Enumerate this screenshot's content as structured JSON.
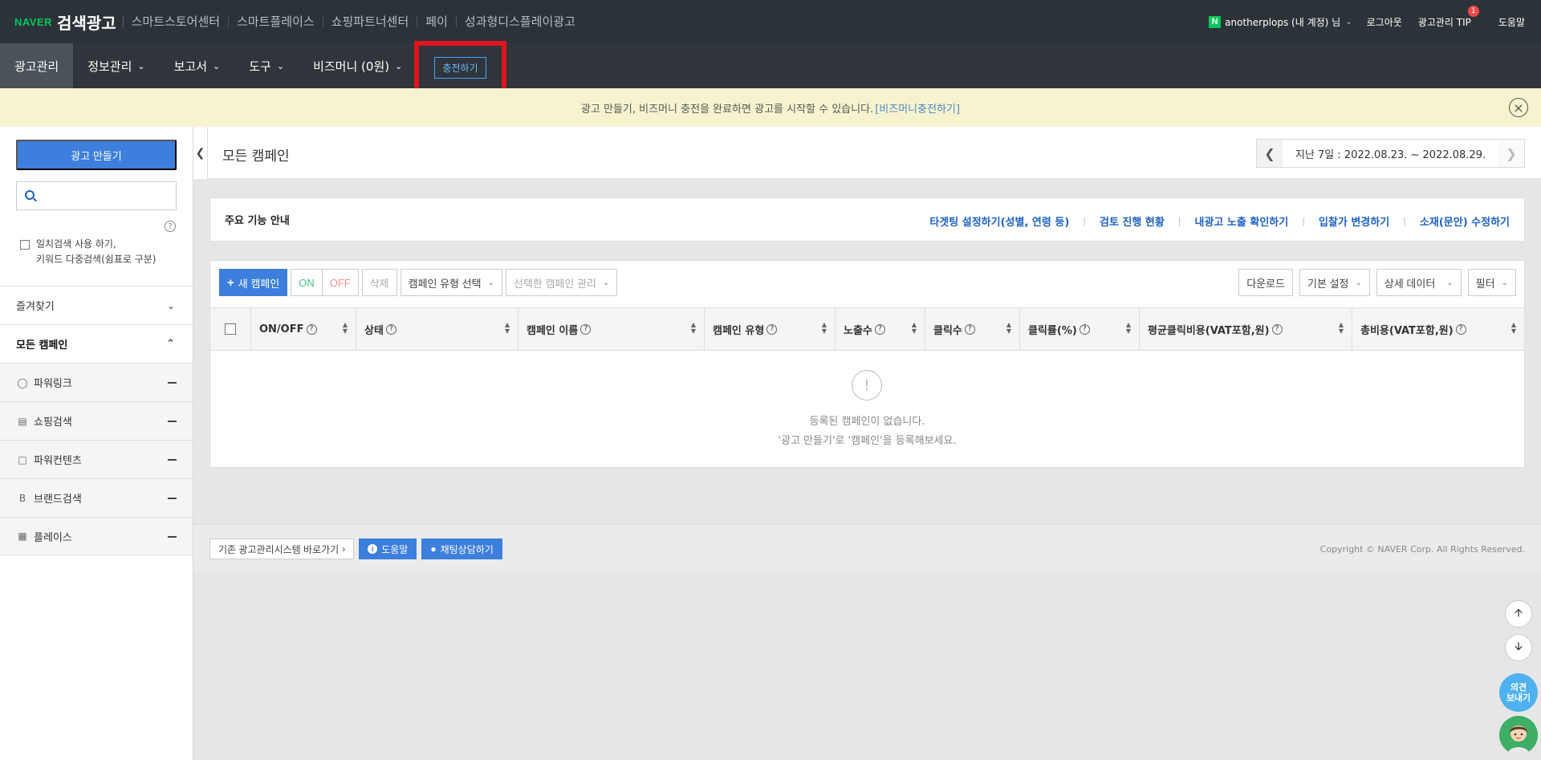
{
  "topbar": {
    "logo_naver": "NAVER",
    "logo_brand": "검색광고",
    "links": [
      "스마트스토어센터",
      "스마트플레이스",
      "쇼핑파트너센터",
      "페이",
      "성과형디스플레이광고"
    ],
    "account": "anotherplops (내 계정) 님",
    "logout": "로그아웃",
    "tip": "광고관리 TIP",
    "tip_badge": "1",
    "help": "도움말",
    "n_icon": "N"
  },
  "mainnav": {
    "items": [
      {
        "label": "광고관리"
      },
      {
        "label": "정보관리"
      },
      {
        "label": "보고서"
      },
      {
        "label": "도구"
      },
      {
        "label": "비즈머니 (0원)"
      }
    ],
    "charge": "충전하기"
  },
  "notice": {
    "text": "광고 만들기, 비즈머니 충전을 완료하면 광고를 시작할 수 있습니다.",
    "link": "[비즈머니충전하기]"
  },
  "sidebar": {
    "create": "광고 만들기",
    "search_placeholder": "",
    "check_line1": "일치검색 사용 하기,",
    "check_line2": "키워드 다중검색(쉼표로 구분)",
    "favorites": "즐겨찾기",
    "all_campaigns": "모든 캠페인",
    "types": [
      "파워링크",
      "쇼핑검색",
      "파워컨텐츠",
      "브랜드검색",
      "플레이스"
    ]
  },
  "header": {
    "title": "모든 캠페인",
    "date_range": "지난 7일 : 2022.08.23. ~ 2022.08.29."
  },
  "guide": {
    "title": "주요 기능 안내",
    "links": [
      "타겟팅 설정하기(성별, 연령 등)",
      "검토 진행 현황",
      "내광고 노출 확인하기",
      "입찰가 변경하기",
      "소재(문안) 수정하기"
    ]
  },
  "toolbar": {
    "new_campaign": "새 캠페인",
    "on": "ON",
    "off": "OFF",
    "delete": "삭제",
    "type_select": "캠페인 유형 선택",
    "manage": "선택한 캠페인 관리",
    "download": "다운로드",
    "basic_setting": "기본 설정",
    "detail_data": "상세 데이터",
    "filter": "필터"
  },
  "table": {
    "columns": [
      "ON/OFF",
      "상태",
      "캠페인 이름",
      "캠페인 유형",
      "노출수",
      "클릭수",
      "클릭률(%)",
      "평균클릭비용(VAT포함,원)",
      "총비용(VAT포함,원)"
    ],
    "empty_line1": "등록된 캠페인이 없습니다.",
    "empty_line2": "'광고 만들기'로 '캠페인'을 등록해보세요."
  },
  "footer": {
    "legacy": "기존 광고관리시스템 바로가기",
    "help": "도움말",
    "chat": "채팅상담하기",
    "copyright": "Copyright © NAVER Corp. All Rights Reserved."
  },
  "floating": {
    "feedback_line1": "의견",
    "feedback_line2": "보내기"
  },
  "colors": {
    "topbar": "#2c3338",
    "accent": "#3d7fdc",
    "highlight_box": "#e0141e",
    "notice_bg": "#f6f4cf",
    "naver_green": "#03c75a"
  }
}
